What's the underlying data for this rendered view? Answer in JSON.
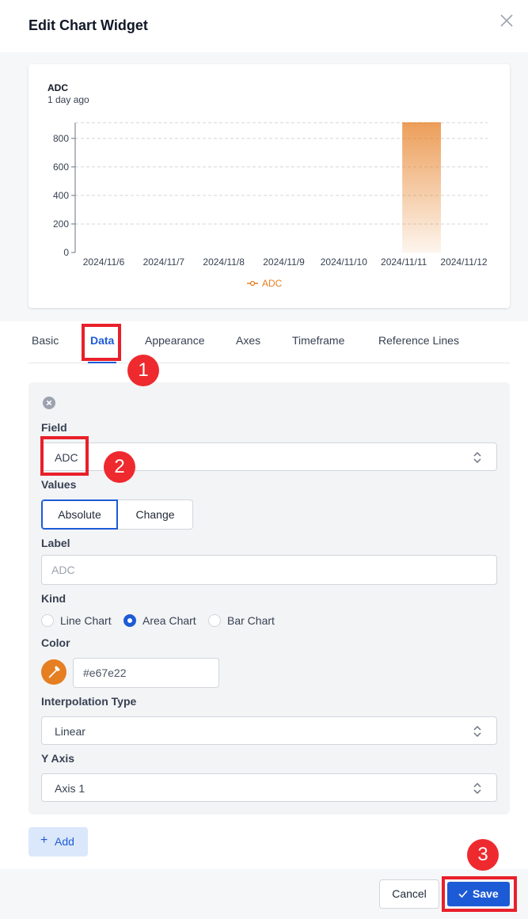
{
  "dialog": {
    "title": "Edit Chart Widget"
  },
  "chart_data": {
    "type": "area",
    "title": "ADC",
    "subtitle": "1 day ago",
    "categories": [
      "2024/11/6",
      "2024/11/7",
      "2024/11/8",
      "2024/11/9",
      "2024/11/10",
      "2024/11/11",
      "2024/11/12"
    ],
    "series": [
      {
        "name": "ADC",
        "values": [
          null,
          null,
          null,
          null,
          null,
          910,
          910
        ],
        "color": "#e67e22"
      }
    ],
    "y_ticks": [
      "800",
      "600",
      "400",
      "200",
      "0"
    ],
    "ylim": [
      0,
      910
    ],
    "grid": true,
    "legend_position": "bottom"
  },
  "tabs": [
    {
      "label": "Basic"
    },
    {
      "label": "Data"
    },
    {
      "label": "Appearance"
    },
    {
      "label": "Axes"
    },
    {
      "label": "Timeframe"
    },
    {
      "label": "Reference Lines"
    }
  ],
  "form": {
    "field_label": "Field",
    "field_value": "ADC",
    "values_label": "Values",
    "values_options": [
      "Absolute",
      "Change"
    ],
    "label_label": "Label",
    "label_placeholder": "ADC",
    "kind_label": "Kind",
    "kind_options": [
      "Line Chart",
      "Area Chart",
      "Bar Chart"
    ],
    "kind_selected": "Area Chart",
    "color_label": "Color",
    "color_value": "#e67e22",
    "interp_label": "Interpolation Type",
    "interp_value": "Linear",
    "yaxis_label": "Y Axis",
    "yaxis_value": "Axis 1"
  },
  "buttons": {
    "add": "Add",
    "cancel": "Cancel",
    "save": "Save"
  },
  "annotations": [
    "1",
    "2",
    "3"
  ],
  "colors": {
    "accent": "#1d5bd6",
    "series": "#e67e22",
    "highlight": "#e8202a"
  }
}
